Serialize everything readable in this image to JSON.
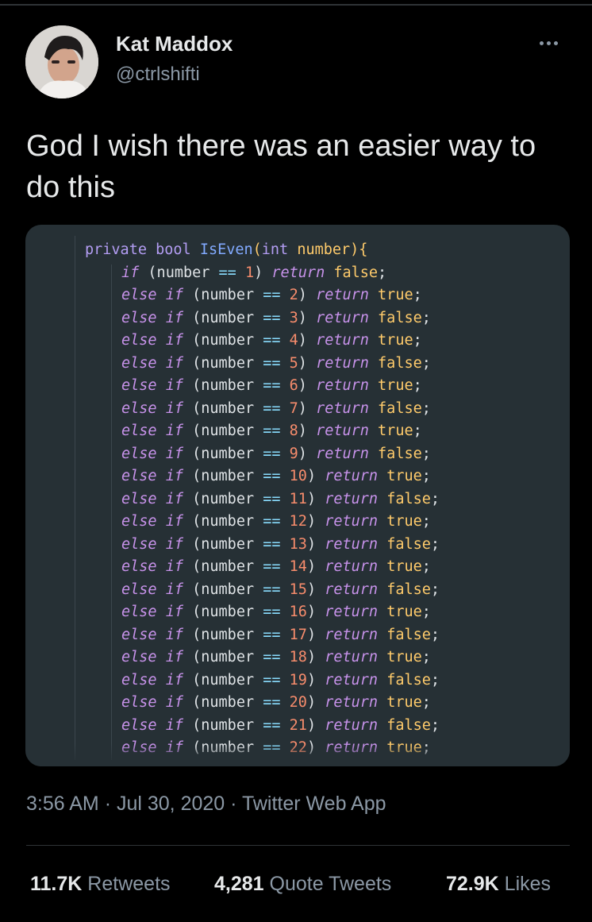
{
  "author": {
    "name": "Kat Maddox",
    "handle": "@ctrlshifti"
  },
  "icons": {
    "avatar": "profile-photo",
    "more": "more-horizontal-icon"
  },
  "tweet": {
    "text": "God I wish there was an easier way to do this"
  },
  "code": {
    "header": {
      "kw": "private",
      "type": "bool",
      "fn": "IsEven",
      "param_type": "int",
      "param_name": "number"
    },
    "first_line": {
      "value": "1",
      "result": "false"
    },
    "cases": [
      {
        "value": "2",
        "result": "true"
      },
      {
        "value": "3",
        "result": "false"
      },
      {
        "value": "4",
        "result": "true"
      },
      {
        "value": "5",
        "result": "false"
      },
      {
        "value": "6",
        "result": "true"
      },
      {
        "value": "7",
        "result": "false"
      },
      {
        "value": "8",
        "result": "true"
      },
      {
        "value": "9",
        "result": "false"
      },
      {
        "value": "10",
        "result": "true"
      },
      {
        "value": "11",
        "result": "false"
      },
      {
        "value": "12",
        "result": "true"
      },
      {
        "value": "13",
        "result": "false"
      },
      {
        "value": "14",
        "result": "true"
      },
      {
        "value": "15",
        "result": "false"
      },
      {
        "value": "16",
        "result": "true"
      },
      {
        "value": "17",
        "result": "false"
      },
      {
        "value": "18",
        "result": "true"
      },
      {
        "value": "19",
        "result": "false"
      },
      {
        "value": "20",
        "result": "true"
      },
      {
        "value": "21",
        "result": "false"
      },
      {
        "value": "22",
        "result": "true"
      }
    ]
  },
  "meta": {
    "time": "3:56 AM",
    "date": "Jul 30, 2020",
    "source": "Twitter Web App",
    "separator": "·"
  },
  "stats": {
    "retweets": {
      "count": "11.7K",
      "label": "Retweets"
    },
    "quotes": {
      "count": "4,281",
      "label": "Quote Tweets"
    },
    "likes": {
      "count": "72.9K",
      "label": "Likes"
    }
  },
  "colors": {
    "background": "#000000",
    "card": "#263035",
    "text": "#e7e9ea",
    "muted": "#8b98a5"
  }
}
